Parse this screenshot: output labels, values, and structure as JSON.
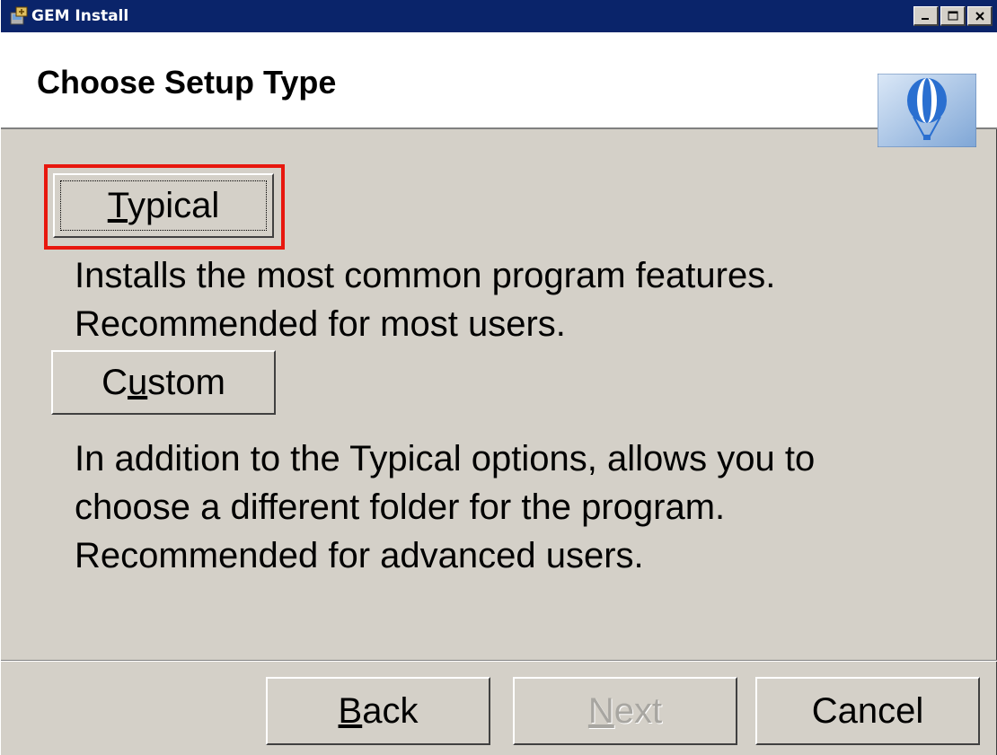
{
  "window": {
    "title": "GEM Install",
    "icon": "installer-icon",
    "controls": [
      "minimize-icon",
      "maximize-icon",
      "close-icon"
    ]
  },
  "header": {
    "heading": "Choose Setup Type",
    "logo": "balloon-logo"
  },
  "options": {
    "typical": {
      "label": "Typical",
      "mnemonic": "T",
      "description": [
        "Installs the most common program features.",
        "Recommended for most users."
      ]
    },
    "custom": {
      "label": "Custom",
      "mnemonic": "u",
      "description": [
        "In addition to the Typical options, allows you to",
        "choose a different folder for the program.",
        "Recommended for advanced users."
      ]
    }
  },
  "footer": {
    "back_label": "Back",
    "next_label": "Next",
    "cancel_label": "Cancel",
    "next_enabled": false
  },
  "colors": {
    "titlebar": "#0a246a",
    "dialog_bg": "#d4d0c8",
    "highlight": "#e8170e"
  }
}
